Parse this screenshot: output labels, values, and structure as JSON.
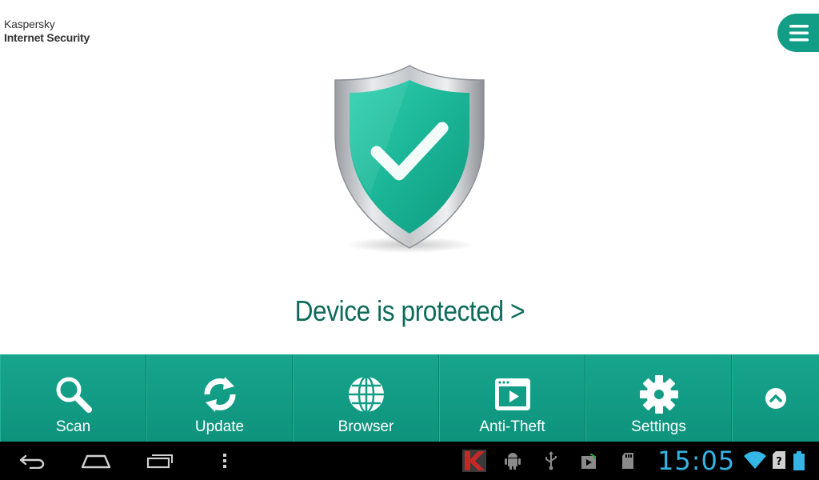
{
  "app": {
    "brand_line1": "Kaspersky",
    "brand_line2": "Internet Security"
  },
  "status": {
    "text": "Device is protected >",
    "color": "#0f6b5b"
  },
  "toolbar": {
    "items": [
      {
        "label": "Scan",
        "icon": "search-icon"
      },
      {
        "label": "Update",
        "icon": "refresh-icon"
      },
      {
        "label": "Browser",
        "icon": "globe-icon"
      },
      {
        "label": "Anti-Theft",
        "icon": "play-screen-icon"
      },
      {
        "label": "Settings",
        "icon": "gear-icon"
      }
    ],
    "more_icon": "chevron-up-icon",
    "accent": "#129e86"
  },
  "system_bar": {
    "time": "15:05",
    "nav_buttons": [
      "back-icon",
      "home-icon",
      "recent-apps-icon",
      "overflow-menu-icon"
    ],
    "notification_icons": [
      "kaspersky-icon",
      "android-debug-icon",
      "usb-icon",
      "cast-icon",
      "sdcard-icon"
    ],
    "status_icons": [
      "wifi-icon",
      "no-sim-icon",
      "battery-icon"
    ],
    "clock_color": "#33b5e5"
  }
}
